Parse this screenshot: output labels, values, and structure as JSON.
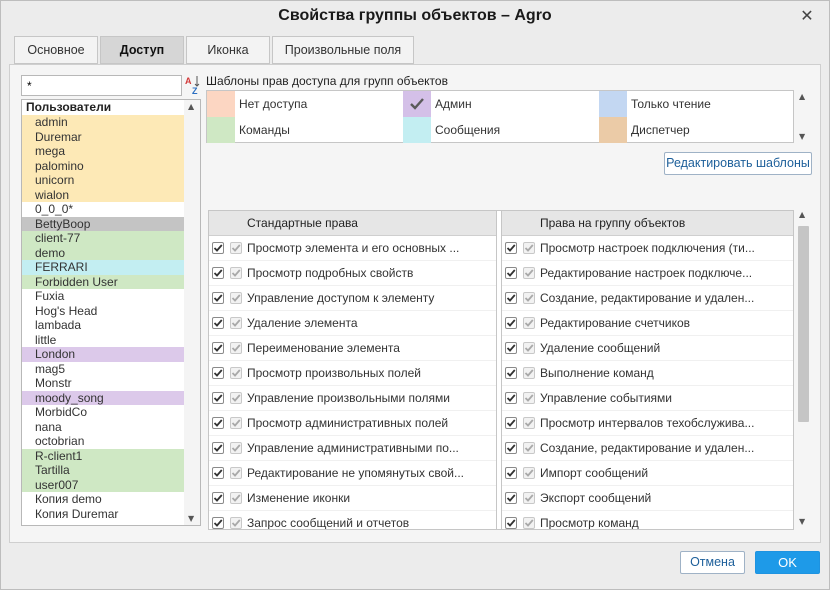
{
  "window": {
    "title": "Свойства группы объектов – Agro"
  },
  "tabs": [
    {
      "label": "Основное",
      "active": false
    },
    {
      "label": "Доступ",
      "active": true
    },
    {
      "label": "Иконка",
      "active": false
    },
    {
      "label": "Произвольные поля",
      "active": false
    }
  ],
  "users_panel": {
    "search_value": "*",
    "header": "Пользователи",
    "items": [
      {
        "label": "admin",
        "color": "#fde9b6"
      },
      {
        "label": "Duremar",
        "color": "#fde9b6"
      },
      {
        "label": "mega",
        "color": "#fde9b6"
      },
      {
        "label": "palomino",
        "color": "#fde9b6"
      },
      {
        "label": "unicorn",
        "color": "#fde9b6"
      },
      {
        "label": "wialon",
        "color": "#fde9b6"
      },
      {
        "label": "0_0_0*",
        "color": "#ffffff"
      },
      {
        "label": "BettyBoop",
        "color": "#c4c4c4"
      },
      {
        "label": "client-77",
        "color": "#cfe8c4"
      },
      {
        "label": "demo",
        "color": "#cfe8c4"
      },
      {
        "label": "FERRARI",
        "color": "#c3eef2"
      },
      {
        "label": "Forbidden User",
        "color": "#cfe8c4"
      },
      {
        "label": "Fuxia",
        "color": "#ffffff"
      },
      {
        "label": "Hog's Head",
        "color": "#ffffff"
      },
      {
        "label": "lambada",
        "color": "#ffffff"
      },
      {
        "label": "little",
        "color": "#ffffff"
      },
      {
        "label": "London",
        "color": "#dcc9ea"
      },
      {
        "label": "mag5",
        "color": "#ffffff"
      },
      {
        "label": "Monstr",
        "color": "#ffffff"
      },
      {
        "label": "moody_song",
        "color": "#dcc9ea"
      },
      {
        "label": "MorbidCo",
        "color": "#ffffff"
      },
      {
        "label": "nana",
        "color": "#ffffff"
      },
      {
        "label": "octobrian",
        "color": "#ffffff"
      },
      {
        "label": "R-client1",
        "color": "#cfe8c4"
      },
      {
        "label": "Tartilla",
        "color": "#cfe8c4"
      },
      {
        "label": "user007",
        "color": "#cfe8c4"
      },
      {
        "label": "Копия demo",
        "color": "#ffffff"
      },
      {
        "label": "Копия Duremar",
        "color": "#ffffff"
      }
    ]
  },
  "templates": {
    "title": "Шаблоны прав доступа для групп объектов",
    "items": [
      {
        "label": "Нет доступа",
        "color": "#fcd6c2",
        "checked": false
      },
      {
        "label": "Админ",
        "color": "#d4c0e8",
        "checked": true
      },
      {
        "label": "Только чтение",
        "color": "#c3d7f2",
        "checked": false
      },
      {
        "label": "Команды",
        "color": "#cfe8c4",
        "checked": false
      },
      {
        "label": "Сообщения",
        "color": "#c3eef2",
        "checked": false
      },
      {
        "label": "Диспетчер",
        "color": "#ebcba7",
        "checked": false
      }
    ],
    "edit_button": "Редактировать шаблоны"
  },
  "rights": {
    "standard_header": "Стандартные права",
    "group_header": "Права на группу объектов",
    "standard": [
      "Просмотр элемента и его основных ...",
      "Просмотр подробных свойств",
      "Управление доступом к элементу",
      "Удаление элемента",
      "Переименование элемента",
      "Просмотр произвольных полей",
      "Управление произвольными полями",
      "Просмотр административных полей",
      "Управление административными по...",
      "Редактирование не упомянутых свой...",
      "Изменение иконки",
      "Запрос сообщений и отчетов"
    ],
    "group": [
      "Просмотр настроек подключения (ти...",
      "Редактирование настроек подключе...",
      "Создание, редактирование и удален...",
      "Редактирование счетчиков",
      "Удаление сообщений",
      "Выполнение команд",
      "Управление событиями",
      "Просмотр интервалов техобслужива...",
      "Создание, редактирование и удален...",
      "Импорт сообщений",
      "Экспорт сообщений",
      "Просмотр команд"
    ]
  },
  "footer": {
    "cancel_label": "Отмена",
    "ok_label": "OK"
  }
}
